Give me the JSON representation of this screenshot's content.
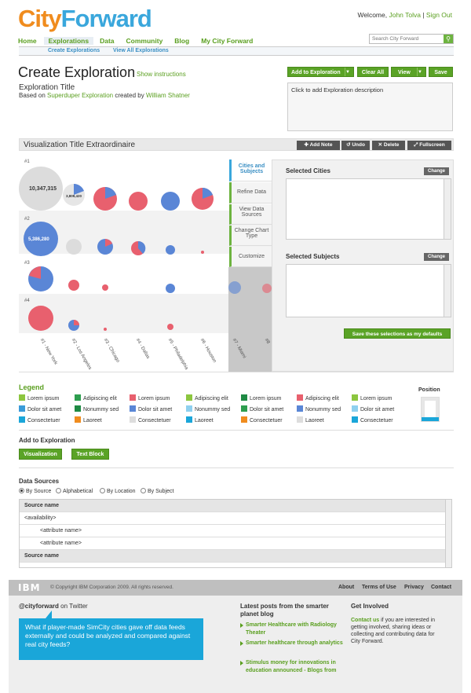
{
  "logo": {
    "part1": "City",
    "part2": "Forward"
  },
  "header": {
    "welcome": "Welcome,",
    "user": "John Tolva",
    "sep": "|",
    "signout": "Sign Out",
    "search_placeholder": "Search City Forward"
  },
  "nav": [
    "Home",
    "Explorations",
    "Data",
    "Community",
    "Blog",
    "My City Forward"
  ],
  "subnav": [
    "Create Explorations",
    "View All Explorations"
  ],
  "page": {
    "title": "Create Exploration",
    "show_instructions": "Show instructions",
    "exploration_title": "Exploration Title",
    "based_prefix": "Based on",
    "based_link": "Superduper Exploration",
    "created_by": "created by",
    "author": "William Shatner",
    "description_placeholder": "Click to add Exploration description"
  },
  "toolbar": {
    "add_to_exploration": "Add to Exploration",
    "clear_all": "Clear All",
    "view": "View",
    "save": "Save"
  },
  "viz": {
    "title": "Visualization Title Extraordinaire",
    "add_note": "Add Note",
    "undo": "Undo",
    "delete": "Delete",
    "fullscreen": "Fullscreen",
    "rows": [
      "#1",
      "#2",
      "#3",
      "#4"
    ],
    "value_1": "10,347,315",
    "value_2": "3,809,420",
    "value_3": "5,386,280",
    "cities": [
      "#1 - New York",
      "#2 - Los Angeles",
      "#3 - Chicago",
      "#4 - Dallas",
      "#5 - Philadelphia",
      "#6 - Houston",
      "#7 - Miami",
      "#8"
    ]
  },
  "sidetabs": [
    "Cities and Subjects",
    "Refine Data",
    "View Data Sources",
    "Change Chart Type",
    "Customize"
  ],
  "panel": {
    "selected_cities": "Selected Cities",
    "selected_subjects": "Selected Subjects",
    "change": "Change",
    "save_defaults": "Save these selections as my defaults"
  },
  "legend": {
    "title": "Legend",
    "position": "Position",
    "items": [
      {
        "label": "Lorem ipsum",
        "color": "#8cc63f"
      },
      {
        "label": "Dolor sit amet",
        "color": "#3a9bd9"
      },
      {
        "label": "Consectetuer",
        "color": "#1aa6d9"
      },
      {
        "label": "Adipiscing elit",
        "color": "#2e9e4f"
      },
      {
        "label": "Nonummy sed",
        "color": "#1f8a44"
      },
      {
        "label": "Laoreet",
        "color": "#f08c1e"
      },
      {
        "label": "Lorem ipsum",
        "color": "#e8606e"
      },
      {
        "label": "Dolor sit amet",
        "color": "#5a86d6"
      },
      {
        "label": "Consectetuer",
        "color": "#dddddd"
      },
      {
        "label": "Adipiscing elit",
        "color": "#8cc63f"
      },
      {
        "label": "Nonummy sed",
        "color": "#8fd0ef"
      },
      {
        "label": "Laoreet",
        "color": "#1aa6d9"
      },
      {
        "label": "Lorem ipsum",
        "color": "#1f8a44"
      },
      {
        "label": "Dolor sit amet",
        "color": "#2e9e4f"
      },
      {
        "label": "Consectetuer",
        "color": "#f08c1e"
      },
      {
        "label": "Adipiscing elit",
        "color": "#e8606e"
      },
      {
        "label": "Nonummy sed",
        "color": "#5a86d6"
      },
      {
        "label": "Laoreet",
        "color": "#dddddd"
      },
      {
        "label": "Lorem ipsum",
        "color": "#8cc63f"
      },
      {
        "label": "Dolor sit amet",
        "color": "#8fd0ef"
      },
      {
        "label": "Consectetuer",
        "color": "#1aa6d9"
      }
    ]
  },
  "add_section": {
    "title": "Add to Exploration",
    "visualization": "Visualization",
    "text_block": "Text Block"
  },
  "sources": {
    "title": "Data Sources",
    "options": [
      "By Source",
      "Alphabetical",
      "By Location",
      "By Subject"
    ],
    "header": "Source name",
    "rows": [
      "<availability>",
      "<attribute name>",
      "<attribute name>"
    ],
    "header2": "Source name"
  },
  "footer": {
    "ibm": "IBM",
    "copyright": "© Copyright IBM Corporation 2009. All rights reserved.",
    "links": [
      "About",
      "Terms of Use",
      "Privacy",
      "Contact"
    ]
  },
  "bottom": {
    "twitter_handle": "@cityforward",
    "twitter_suffix": "on Twitter",
    "tweet": "What if player-made SimCity cities gave off data feeds externally and could be analyzed and compared against real city feeds?",
    "blog_title": "Latest posts from the smarter planet blog",
    "posts": [
      "Smarter Healthcare with Radiology Theater",
      "Smarter healthcare through analytics",
      "Stimulus money for innovations in education announced - Blogs from"
    ],
    "involved_title": "Get Involved",
    "contact_link": "Contact us",
    "involved_text": "if you are interested in getting involved, sharing ideas or collecting and contributing data for City Forward."
  }
}
